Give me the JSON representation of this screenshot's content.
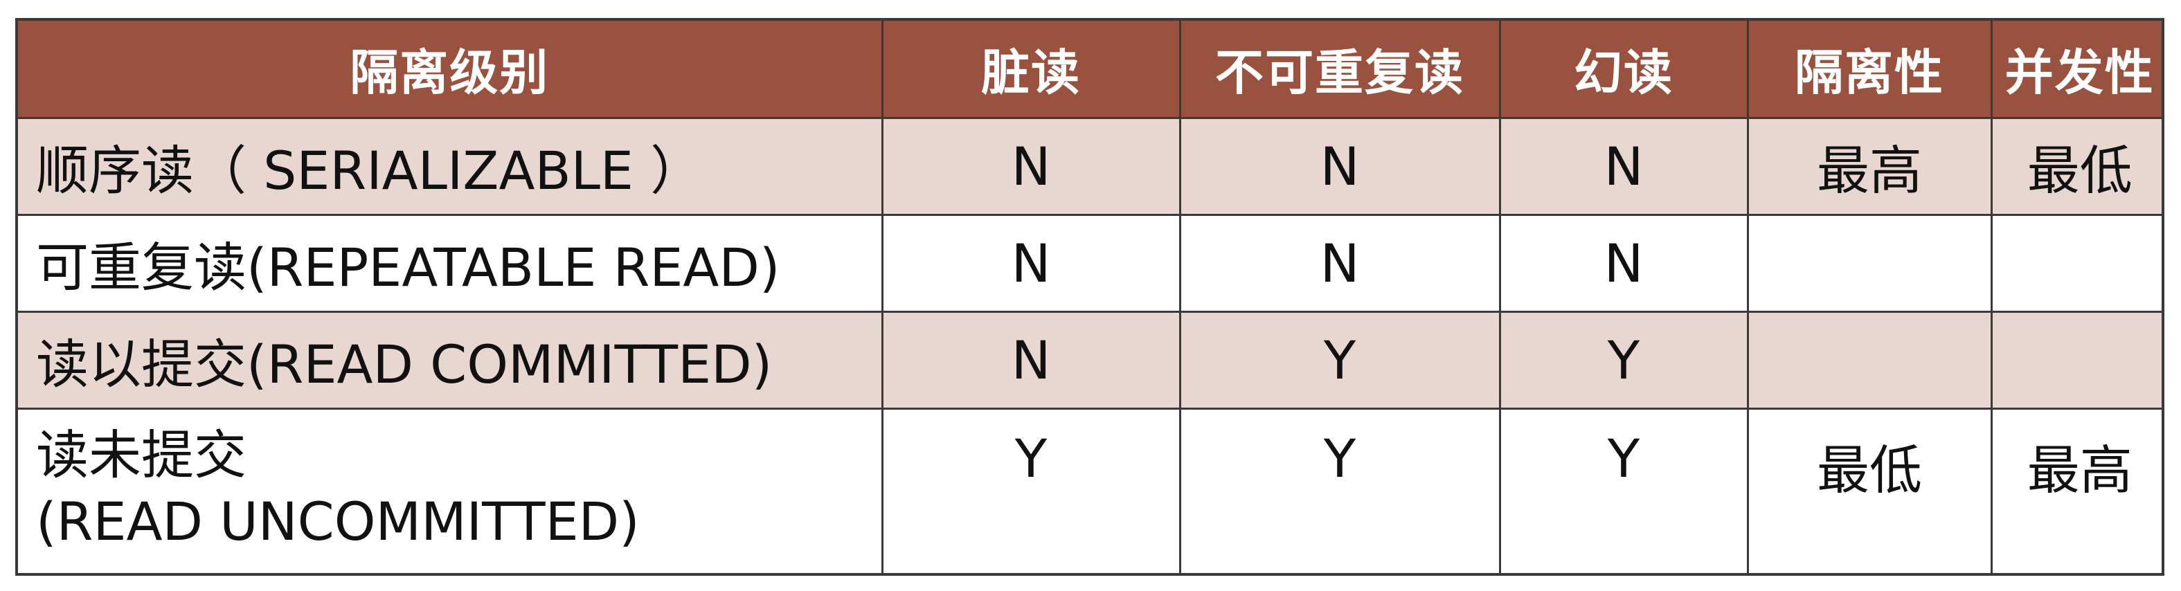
{
  "table": {
    "headers": [
      "隔离级别",
      "脏读",
      "不可重复读",
      "幻读",
      "隔离性",
      "并发性"
    ],
    "rows": [
      {
        "level": [
          "顺序读（ SERIALIZABLE ）"
        ],
        "dirty_read": "N",
        "non_repeatable_read": "N",
        "phantom_read": "N",
        "isolation": "最高",
        "concurrency": "最低"
      },
      {
        "level": [
          "可重复读(REPEATABLE READ)"
        ],
        "dirty_read": "N",
        "non_repeatable_read": "N",
        "phantom_read": "N",
        "isolation": "",
        "concurrency": ""
      },
      {
        "level": [
          "读以提交(READ COMMITTED)"
        ],
        "dirty_read": "N",
        "non_repeatable_read": "Y",
        "phantom_read": "Y",
        "isolation": "",
        "concurrency": ""
      },
      {
        "level": [
          "读未提交",
          "(READ UNCOMMITTED)"
        ],
        "dirty_read": "Y",
        "non_repeatable_read": "Y",
        "phantom_read": "Y",
        "isolation": "最低",
        "concurrency": "最高"
      }
    ]
  },
  "colors": {
    "header_bg": "#9a5240",
    "header_text": "#ffffff",
    "shaded_row_bg": "#e8d6d1",
    "highlight_text": "#a8302a",
    "border": "#3a3a3a"
  }
}
